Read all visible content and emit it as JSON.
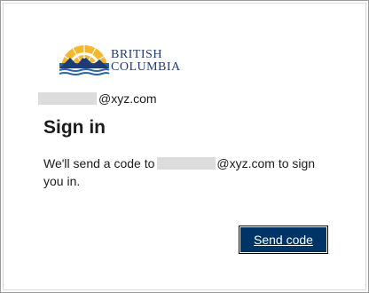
{
  "logo": {
    "line1": "BRITISH",
    "line2": "COLUMBIA",
    "colors": {
      "navy": "#1f3b73",
      "gold": "#f3b82e",
      "sky": "#2a64a8"
    }
  },
  "account": {
    "domain": "@xyz.com"
  },
  "title": "Sign in",
  "message": {
    "before": "We'll send a code to",
    "domain": "@xyz.com",
    "after": "to sign you in."
  },
  "button": {
    "label": "Send code",
    "color": "#003366"
  }
}
